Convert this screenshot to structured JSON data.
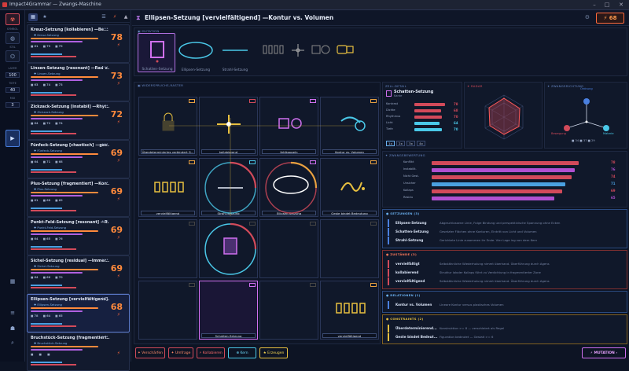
{
  "window": {
    "title": "Impact4Grammar — Zwangs-Maschine"
  },
  "rail": {
    "labels": [
      "SYMBOL",
      "STIL",
      "LAYER",
      "TIEFE",
      "MIX"
    ],
    "values": [
      "100",
      "40",
      "3"
    ],
    "bottom": [
      "FULL",
      "MAP",
      "FOCUS",
      "TOOLS"
    ]
  },
  "cards": [
    {
      "title": "Kreuz-Setzung [kollabieren] —Be...",
      "sub": "Kreuz-Setzung",
      "score": "78",
      "s1": "61",
      "s2": "79",
      "s3": "79"
    },
    {
      "title": "Linsen-Setzung [resonant] —Rad v...",
      "sub": "Linsen-Setzung",
      "score": "73",
      "s1": "63",
      "s2": "74",
      "s3": "73"
    },
    {
      "title": "Zickzack-Setzung [instabil] —Rhyt...",
      "sub": "Zickzack-Setzung",
      "score": "72",
      "s1": "64",
      "s2": "72",
      "s3": "74"
    },
    {
      "title": "Fünfeck-Setzung [chaotisch] —ges...",
      "sub": "Fünfeck-Setzung",
      "score": "69",
      "s1": "64",
      "s2": "71",
      "s3": "68"
    },
    {
      "title": "Plus-Setzung [fragmentiert] —Kon...",
      "sub": "Plus-Setzung",
      "score": "69",
      "s1": "61",
      "s2": "68",
      "s3": "69"
    },
    {
      "title": "Punkt-Feld-Setzung [resonant] —R...",
      "sub": "Punkt-Feld-Setzung",
      "score": "69",
      "s1": "64",
      "s2": "65",
      "s3": "76"
    },
    {
      "title": "Sichel-Setzung [residual] —Immer...",
      "sub": "Sichel-Setzung",
      "score": "69",
      "s1": "64",
      "s2": "66",
      "s3": "70"
    },
    {
      "title": "Ellipsen-Setzung [vervielfältigend]...",
      "sub": "Ellipsen-Setzung",
      "score": "68",
      "s1": "78",
      "s2": "64",
      "s3": "65"
    },
    {
      "title": "Bruchstück-Setzung [fragmentiert...",
      "sub": "Bruchstück-Setzung",
      "score": "",
      "s1": "",
      "s2": "",
      "s3": ""
    }
  ],
  "main": {
    "title": "Ellipsen-Setzung [vervielfältigend] —Kontur vs. Volumen",
    "score": "68",
    "mutation_label": "MUTATION",
    "grid_label": "WIDERSPRUCHS-RASTER",
    "slots": [
      "Schatten-Setzung",
      "Ellipsen-Setzung",
      "Strahl-Setzung",
      "vervielfältigend",
      "kollabieren",
      "Kontur vs. Volumen"
    ],
    "cells": [
      "Überdeterminiertes verbindert G...",
      "kollabierend",
      "fehlkoppeln",
      "Kontur vs. Volumen",
      "vervielfältigend",
      "Strahl-Setzung",
      "Ellipsen-Setzung",
      "Geste bindet Bedeutung",
      "",
      "",
      "",
      "",
      "",
      "Schatten-Setzung",
      "",
      "vervielfältigend",
      "",
      "",
      "",
      ""
    ]
  },
  "right": {
    "cell_title": "ZELL-DETAIL",
    "cell_name": "Schatten-Setzung",
    "cell_sub": "Kante",
    "bars_top": [
      {
        "label": "Kontrast",
        "value": "78"
      },
      {
        "label": "Dichte",
        "value": "68"
      },
      {
        "label": "Rhythmus",
        "value": "70"
      },
      {
        "label": "Licht",
        "value": "64"
      },
      {
        "label": "Tiefe",
        "value": "70"
      }
    ],
    "tabs": [
      "1x",
      "2x",
      "3x",
      "4x"
    ],
    "radar_title": "RADAR",
    "compass_title": "ZWANGSRICHTUNG",
    "compass_labels": [
      "Ordnung",
      "Bewegung",
      "Materie"
    ],
    "compass_vals": [
      "34",
      "37",
      "29"
    ],
    "zwang_title": "ZWANGSBEWERTUNG",
    "zwang": [
      {
        "label": "Konflikt",
        "value": "78",
        "color": "#d24a5a"
      },
      {
        "label": "Instabilit.",
        "value": "76",
        "color": "#b050d0"
      },
      {
        "label": "Nicht Gest.",
        "value": "74",
        "color": "#d24a5a"
      },
      {
        "label": "Unsicher",
        "value": "71",
        "color": "#4aa0e0"
      },
      {
        "label": "Kollaps",
        "value": "69",
        "color": "#d24a5a"
      },
      {
        "label": "Residu",
        "value": "65",
        "color": "#b050d0"
      }
    ],
    "setz_title": "SETZUNGEN (3)",
    "setz": [
      {
        "name": "Ellipsen-Setzung",
        "desc": "Abgeschlossene Linie, Folge Bindung und perspektivische Spannung ohne Ecken"
      },
      {
        "name": "Schatten-Setzung",
        "desc": "Gesetzter Flächen ohne Konturen, Eintritt von Licht und Volumen"
      },
      {
        "name": "Strahl-Setzung",
        "desc": "Gerichtete Linie zusammen ihr Ende. Vier Lage ing von dem Kern"
      }
    ],
    "zust_title": "ZUSTÄNDE (3)",
    "zust": [
      {
        "name": "vervielfältigt",
        "desc": "Selbstähnliche Wiederholung nimmt überhand. Überführung durch Agens"
      },
      {
        "name": "kollabierend",
        "desc": "Struktur lokaler Kollaps führt zu Verdichtung in fragmentierter Zone"
      },
      {
        "name": "vervielfältigend",
        "desc": "Selbstähnliche Wiederholung nimmt überhand. Überführung durch Agens"
      }
    ],
    "rel_title": "RELATIONEN (1)",
    "rel": [
      {
        "name": "Kontur vs. Volumen",
        "desc": "Lineare Kontur versus plastisches Volumen"
      }
    ],
    "con_title": "CONSTRAINTS (2)",
    "con": [
      {
        "name": "Überdeterminierend...",
        "desc": "Konstruktion >= 8 — verschleiert als Regel"
      },
      {
        "name": "Geste bindet Bedeut...",
        "desc": "Figuration bedeutet — Gestalt >= 6"
      }
    ]
  },
  "bottom": {
    "buttons": [
      "Verschärfen",
      "Umfrage",
      "Kollabieren",
      "Kern",
      "Erzeugen"
    ],
    "mutation": "MUTATION"
  },
  "colors": {
    "accent": "#ff8a3c",
    "purple": "#b060e0",
    "cyan": "#4ac8e8"
  }
}
